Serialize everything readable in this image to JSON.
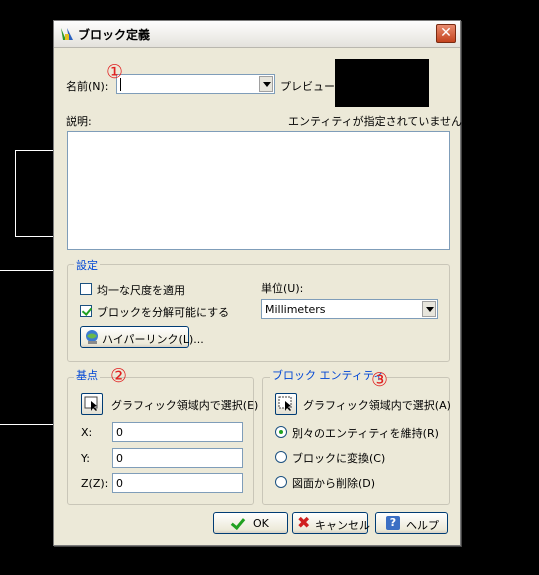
{
  "dialog": {
    "title": "ブロック定義",
    "close_glyph": "✕",
    "name_label": "名前(N):",
    "name_value": "",
    "preview_label": "プレビュー:",
    "no_entity_msg": "エンティティが指定されていません。",
    "description_label": "説明:",
    "settings": {
      "title": "設定",
      "uniform_scale": "均一な尺度を適用",
      "allow_explode": "ブロックを分解可能にする",
      "units_label": "単位(U):",
      "units_value": "Millimeters",
      "hyperlink_button": "ハイパーリンク(L)..."
    },
    "base_point": {
      "title": "基点",
      "pick_label": "グラフィック領域内で選択(E)",
      "x_label": "X:",
      "x_value": "0",
      "y_label": "Y:",
      "y_value": "0",
      "z_label": "Z(Z):",
      "z_value": "0"
    },
    "block_entity": {
      "title": "ブロック エンティティ",
      "pick_label": "グラフィック領域内で選択(A)",
      "retain": "別々のエンティティを維持(R)",
      "convert": "ブロックに変換(C)",
      "delete": "図面から削除(D)"
    },
    "buttons": {
      "ok": "OK",
      "cancel": "キャンセル",
      "help": "ヘルプ"
    }
  },
  "annotations": [
    "①",
    "②",
    "③"
  ],
  "colors": {
    "annotation": "#e02020",
    "group_title": "#0046d5",
    "ok_icon": "#21a121",
    "cancel_icon": "#d02020"
  }
}
